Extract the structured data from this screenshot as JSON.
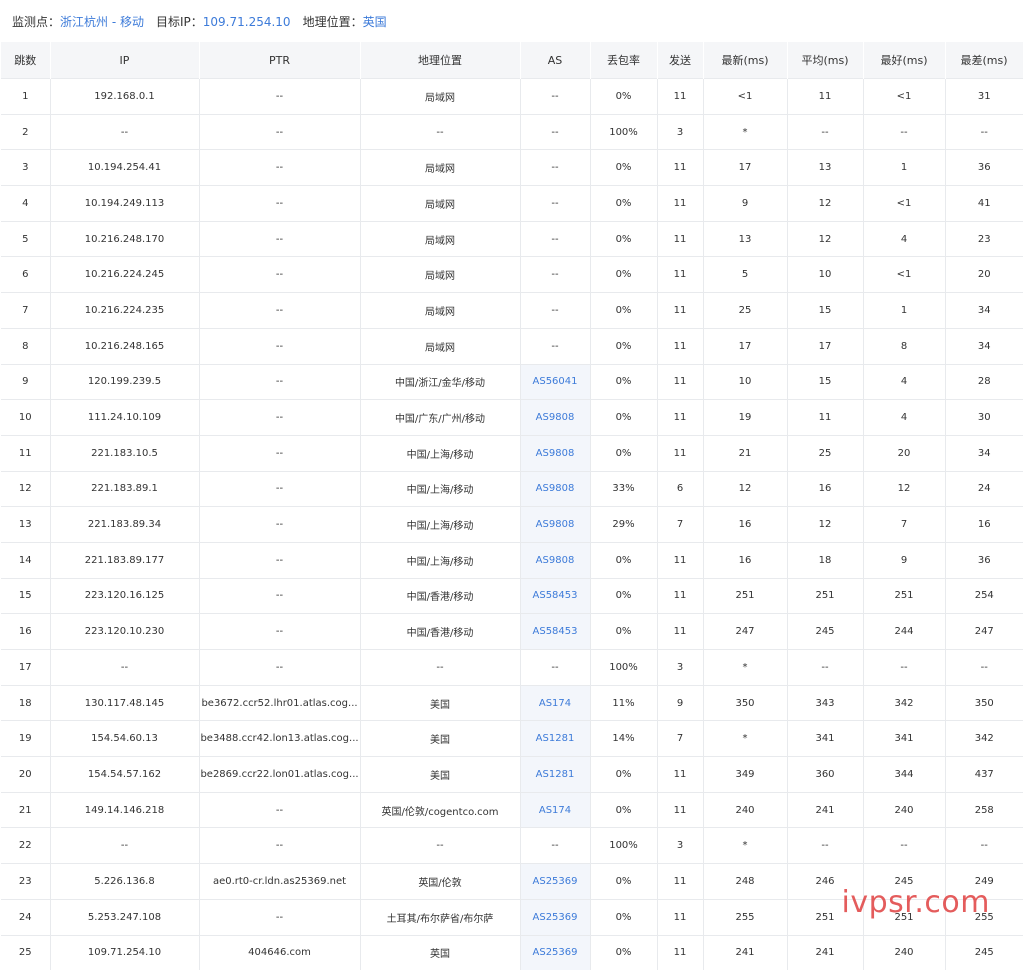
{
  "header": {
    "monitor_label": "监测点：",
    "monitor_value": "浙江杭州 - 移动",
    "target_label": "目标IP：",
    "target_value": "109.71.254.10",
    "geo_label": "地理位置：",
    "geo_value": "英国"
  },
  "columns": [
    "跳数",
    "IP",
    "PTR",
    "地理位置",
    "AS",
    "丢包率",
    "发送",
    "最新(ms)",
    "平均(ms)",
    "最好(ms)",
    "最差(ms)"
  ],
  "rows": [
    [
      "1",
      "192.168.0.1",
      "--",
      "局域网",
      "--",
      "0%",
      "11",
      "<1",
      "11",
      "<1",
      "31"
    ],
    [
      "2",
      "--",
      "--",
      "--",
      "--",
      "100%",
      "3",
      "*",
      "--",
      "--",
      "--"
    ],
    [
      "3",
      "10.194.254.41",
      "--",
      "局域网",
      "--",
      "0%",
      "11",
      "17",
      "13",
      "1",
      "36"
    ],
    [
      "4",
      "10.194.249.113",
      "--",
      "局域网",
      "--",
      "0%",
      "11",
      "9",
      "12",
      "<1",
      "41"
    ],
    [
      "5",
      "10.216.248.170",
      "--",
      "局域网",
      "--",
      "0%",
      "11",
      "13",
      "12",
      "4",
      "23"
    ],
    [
      "6",
      "10.216.224.245",
      "--",
      "局域网",
      "--",
      "0%",
      "11",
      "5",
      "10",
      "<1",
      "20"
    ],
    [
      "7",
      "10.216.224.235",
      "--",
      "局域网",
      "--",
      "0%",
      "11",
      "25",
      "15",
      "1",
      "34"
    ],
    [
      "8",
      "10.216.248.165",
      "--",
      "局域网",
      "--",
      "0%",
      "11",
      "17",
      "17",
      "8",
      "34"
    ],
    [
      "9",
      "120.199.239.5",
      "--",
      "中国/浙江/金华/移动",
      "AS56041",
      "0%",
      "11",
      "10",
      "15",
      "4",
      "28"
    ],
    [
      "10",
      "111.24.10.109",
      "--",
      "中国/广东/广州/移动",
      "AS9808",
      "0%",
      "11",
      "19",
      "11",
      "4",
      "30"
    ],
    [
      "11",
      "221.183.10.5",
      "--",
      "中国/上海/移动",
      "AS9808",
      "0%",
      "11",
      "21",
      "25",
      "20",
      "34"
    ],
    [
      "12",
      "221.183.89.1",
      "--",
      "中国/上海/移动",
      "AS9808",
      "33%",
      "6",
      "12",
      "16",
      "12",
      "24"
    ],
    [
      "13",
      "221.183.89.34",
      "--",
      "中国/上海/移动",
      "AS9808",
      "29%",
      "7",
      "16",
      "12",
      "7",
      "16"
    ],
    [
      "14",
      "221.183.89.177",
      "--",
      "中国/上海/移动",
      "AS9808",
      "0%",
      "11",
      "16",
      "18",
      "9",
      "36"
    ],
    [
      "15",
      "223.120.16.125",
      "--",
      "中国/香港/移动",
      "AS58453",
      "0%",
      "11",
      "251",
      "251",
      "251",
      "254"
    ],
    [
      "16",
      "223.120.10.230",
      "--",
      "中国/香港/移动",
      "AS58453",
      "0%",
      "11",
      "247",
      "245",
      "244",
      "247"
    ],
    [
      "17",
      "--",
      "--",
      "--",
      "--",
      "100%",
      "3",
      "*",
      "--",
      "--",
      "--"
    ],
    [
      "18",
      "130.117.48.145",
      "be3672.ccr52.lhr01.atlas.cog...",
      "美国",
      "AS174",
      "11%",
      "9",
      "350",
      "343",
      "342",
      "350"
    ],
    [
      "19",
      "154.54.60.13",
      "be3488.ccr42.lon13.atlas.cog...",
      "美国",
      "AS1281",
      "14%",
      "7",
      "*",
      "341",
      "341",
      "342"
    ],
    [
      "20",
      "154.54.57.162",
      "be2869.ccr22.lon01.atlas.cog...",
      "美国",
      "AS1281",
      "0%",
      "11",
      "349",
      "360",
      "344",
      "437"
    ],
    [
      "21",
      "149.14.146.218",
      "--",
      "英国/伦敦/cogentco.com",
      "AS174",
      "0%",
      "11",
      "240",
      "241",
      "240",
      "258"
    ],
    [
      "22",
      "--",
      "--",
      "--",
      "--",
      "100%",
      "3",
      "*",
      "--",
      "--",
      "--"
    ],
    [
      "23",
      "5.226.136.8",
      "ae0.rt0-cr.ldn.as25369.net",
      "英国/伦敦",
      "AS25369",
      "0%",
      "11",
      "248",
      "246",
      "245",
      "249"
    ],
    [
      "24",
      "5.253.247.108",
      "--",
      "土耳其/布尔萨省/布尔萨",
      "AS25369",
      "0%",
      "11",
      "255",
      "251",
      "251",
      "255"
    ],
    [
      "25",
      "109.71.254.10",
      "404646.com",
      "英国",
      "AS25369",
      "0%",
      "11",
      "241",
      "241",
      "240",
      "245"
    ]
  ],
  "watermark": "ivpsr.com",
  "colors": {
    "link": "#3d7bd9",
    "header_bg": "#f5f6f8",
    "watermark": "#e04040"
  }
}
